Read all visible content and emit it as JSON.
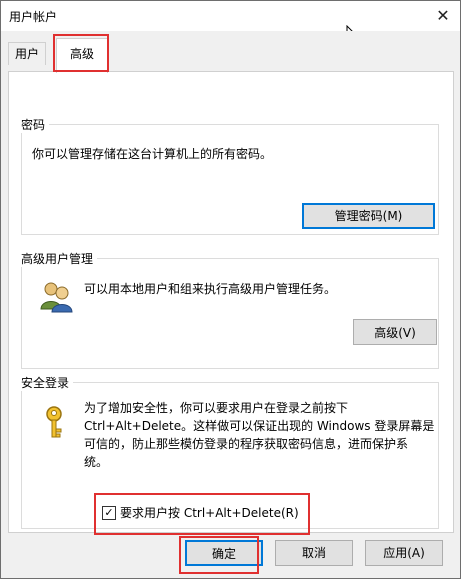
{
  "window": {
    "title": "用户帐户",
    "close_glyph": "✕"
  },
  "tabs": [
    {
      "label": "用户",
      "selected": false
    },
    {
      "label": "高级",
      "selected": true
    }
  ],
  "password_group": {
    "label": "密码",
    "description": "你可以管理存储在这台计算机上的所有密码。",
    "button_label": "管理密码(M)"
  },
  "admin_group": {
    "label": "高级用户管理",
    "description": "可以用本地用户和组来执行高级用户管理任务。",
    "button_label": "高级(V)"
  },
  "secure_group": {
    "label": "安全登录",
    "description_lines": [
      "为了增加安全性，你可以要求用户在登录之前按下",
      "Ctrl+Alt+Delete。这样做可以保证出现的 Windows 登录屏幕是",
      "可信的，防止那些模仿登录的程序获取密码信息，进而保护系",
      "统。"
    ],
    "checkbox_label": "要求用户按 Ctrl+Alt+Delete(R)",
    "checkbox_checked": true,
    "check_glyph": "✓"
  },
  "footer": {
    "ok_label": "确定",
    "cancel_label": "取消",
    "apply_label": "应用(A)"
  },
  "colors": {
    "highlight": "#e03030",
    "focus_border": "#0078d7"
  }
}
